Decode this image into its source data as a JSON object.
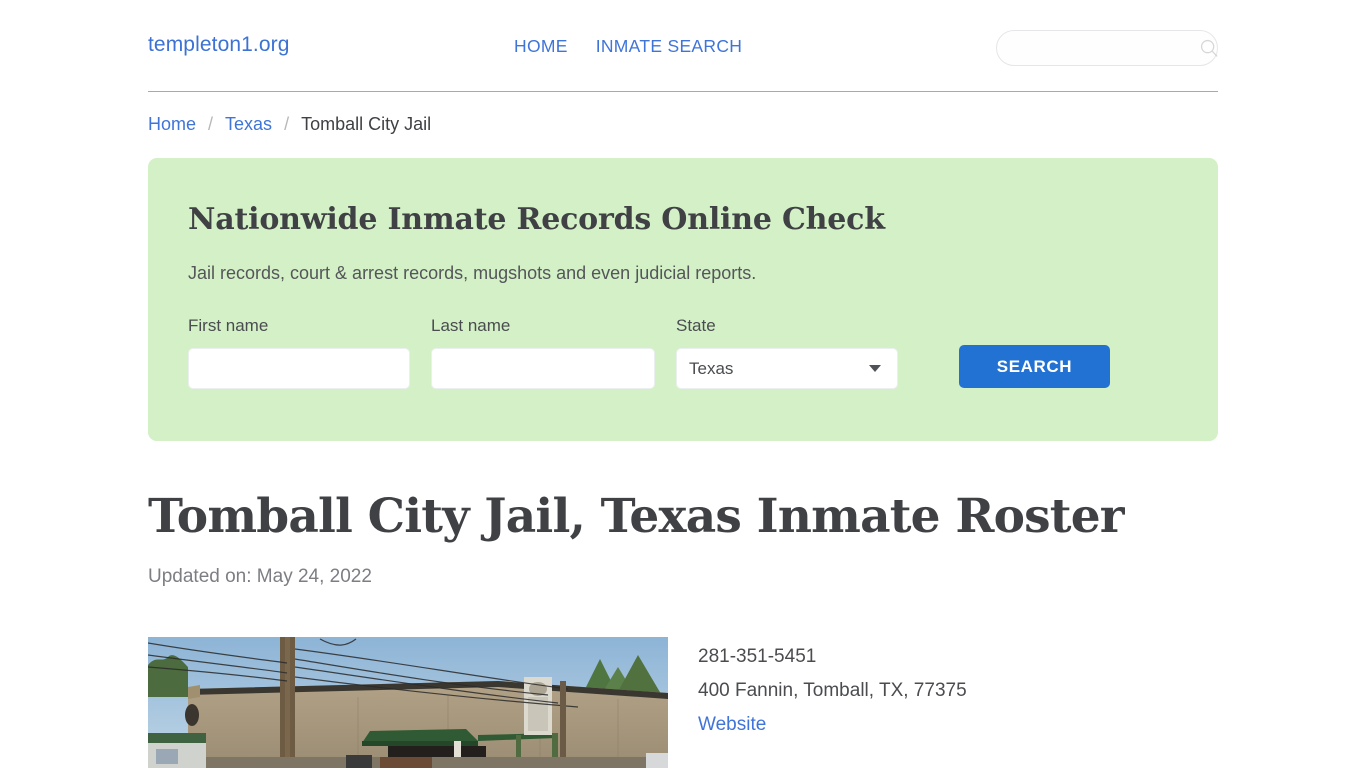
{
  "header": {
    "brand": "templeton1.org",
    "nav": [
      {
        "label": "HOME"
      },
      {
        "label": "INMATE SEARCH"
      }
    ],
    "search": {
      "value": "",
      "placeholder": "",
      "icon": "search-icon"
    }
  },
  "breadcrumb": {
    "items": [
      {
        "label": "Home",
        "link": true
      },
      {
        "label": "Texas",
        "link": true
      },
      {
        "label": "Tomball City Jail",
        "link": false
      }
    ],
    "separator": "/"
  },
  "promo": {
    "heading": "Nationwide Inmate Records Online Check",
    "subtitle": "Jail records, court & arrest records, mugshots and even judicial reports.",
    "background_color": "#d3f0c6",
    "form": {
      "first_name": {
        "label": "First name",
        "value": "",
        "placeholder": ""
      },
      "last_name": {
        "label": "Last name",
        "value": "",
        "placeholder": ""
      },
      "state": {
        "label": "State",
        "value": "Texas",
        "caret_icon": "chevron-down-icon"
      },
      "submit": {
        "label": "SEARCH",
        "color": "#2272d4"
      }
    }
  },
  "main": {
    "title": "Tomball City Jail, Texas Inmate Roster",
    "updated": "Updated on: May 24, 2022",
    "facility_photo": {
      "alt": "Tomball City Jail building exterior street view"
    },
    "contact": {
      "phone": "281-351-5451",
      "address": "400 Fannin, Tomball, TX, 77375",
      "website_label": "Website"
    }
  },
  "colors": {
    "link": "#3f74d8",
    "accent": "#2272d4",
    "panel_green": "#d3f0c6",
    "text": "#3f4145"
  }
}
